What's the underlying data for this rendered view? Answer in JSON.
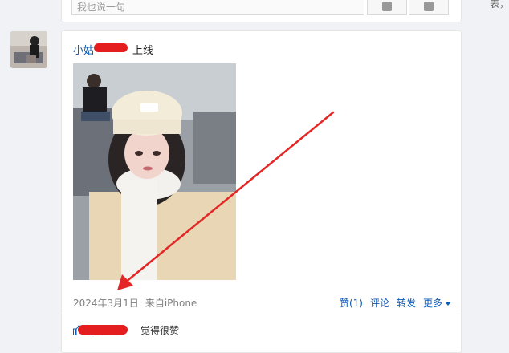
{
  "side": {
    "text": "表，"
  },
  "prev_post": {
    "comment_placeholder": "我也说一句"
  },
  "post": {
    "username": "小姑",
    "status": "上线",
    "date": "2024年3月1日",
    "source": "来自iPhone",
    "actions": {
      "like": "赞(1)",
      "comment": "评论",
      "repost": "转发",
      "more": "更多"
    },
    "likes": {
      "names": "小姑",
      "suffix": "觉得很赞"
    }
  },
  "colors": {
    "link": "#0e5bb5",
    "redaction": "#e41e1e",
    "arrow": "#e32626"
  }
}
